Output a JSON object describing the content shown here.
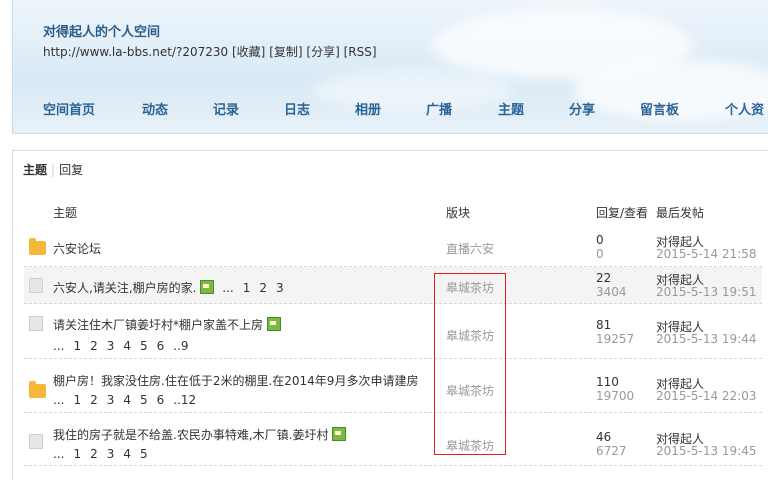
{
  "header": {
    "title": "对得起人的个人空间",
    "url": "http://www.la-bbs.net/?207230",
    "actions": [
      "[收藏]",
      "[复制]",
      "[分享]",
      "[RSS]"
    ]
  },
  "nav": [
    "空间首页",
    "动态",
    "记录",
    "日志",
    "相册",
    "广播",
    "主题",
    "分享",
    "留言板",
    "个人资"
  ],
  "tabs": {
    "active": "主题",
    "other": "回复"
  },
  "columns": {
    "topic": "主题",
    "board": "版块",
    "reply_view": "回复/查看",
    "last_post": "最后发帖"
  },
  "rows": [
    {
      "title": "六安论坛",
      "board": "直播六安",
      "replies": "0",
      "views": "0",
      "author": "对得起人",
      "time": "2015-5-14 21:58"
    },
    {
      "title": "六安人,请关注,棚户房的家.",
      "pages": [
        "...",
        "1",
        "2",
        "3"
      ],
      "board": "皋城茶坊",
      "replies": "22",
      "views": "3404",
      "author": "对得起人",
      "time": "2015-5-13 19:51"
    },
    {
      "title": "请关注住木厂镇姜圩村*棚户家盖不上房",
      "pages": [
        "...",
        "1",
        "2",
        "3",
        "4",
        "5",
        "6",
        "..9"
      ],
      "board": "皋城茶坊",
      "replies": "81",
      "views": "19257",
      "author": "对得起人",
      "time": "2015-5-13 19:44"
    },
    {
      "title": "棚户房！我家没住房.住在低于2米的棚里.在2014年9月多次申请建房",
      "pages": [
        "...",
        "1",
        "2",
        "3",
        "4",
        "5",
        "6",
        "..12"
      ],
      "board": "皋城茶坊",
      "replies": "110",
      "views": "19700",
      "author": "对得起人",
      "time": "2015-5-14 22:03"
    },
    {
      "title": "我住的房子就是不给盖.农民办事特难,木厂镇.姜圩村",
      "pages": [
        "...",
        "1",
        "2",
        "3",
        "4",
        "5"
      ],
      "board": "皋城茶坊",
      "replies": "46",
      "views": "6727",
      "author": "对得起人",
      "time": "2015-5-13 19:45"
    }
  ]
}
